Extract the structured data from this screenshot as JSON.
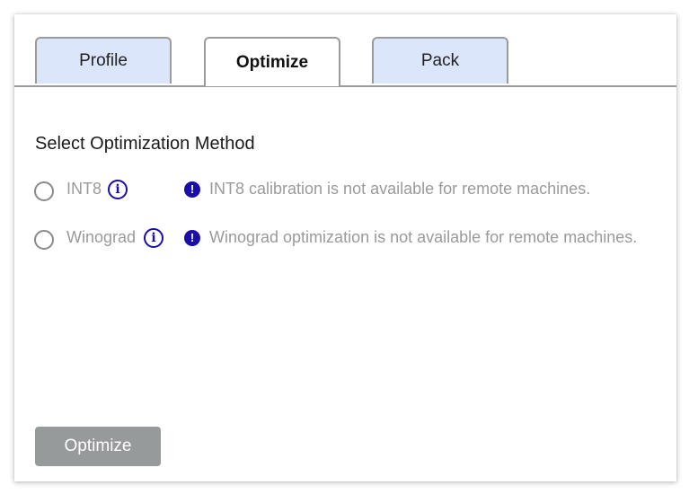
{
  "tabs": {
    "profile": {
      "label": "Profile"
    },
    "optimize": {
      "label": "Optimize"
    },
    "pack": {
      "label": "Pack"
    }
  },
  "active_tab": "Optimize",
  "section": {
    "title": "Select Optimization Method"
  },
  "options": {
    "int8": {
      "label": "INT8",
      "info_icon": "info-icon",
      "warning_icon": "exclamation-icon",
      "warning": "INT8 calibration is not available for remote machines."
    },
    "winograd": {
      "label": "Winograd",
      "info_icon": "info-icon",
      "warning_icon": "exclamation-icon",
      "warning": "Winograd optimization is not available for remote machines."
    }
  },
  "actions": {
    "optimize_label": "Optimize"
  },
  "colors": {
    "tab_inactive_bg": "#dce6fb",
    "accent": "#1a0dab",
    "disabled_text": "#9a9a9a",
    "button_disabled_bg": "#969a9a"
  }
}
